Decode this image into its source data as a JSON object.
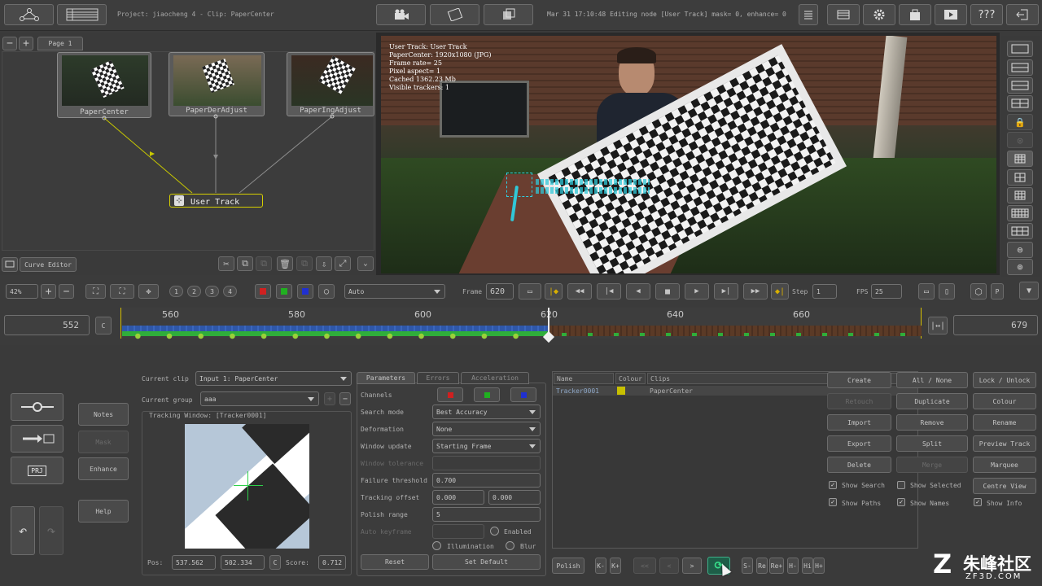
{
  "top": {
    "project_label": "Project: jiaocheng 4 - Clip: PaperCenter",
    "status_text": "Mar 31 17:10:48 Editing node [User Track] mask= 0, enhance= 0",
    "help_label": "???"
  },
  "flow": {
    "tab_page": "Page 1",
    "nodes": [
      {
        "label": "PaperCenter"
      },
      {
        "label": "PaperDerAdjust"
      },
      {
        "label": "PaperIngAdjust"
      }
    ],
    "user_track_label": "User Track",
    "curve_editor_label": "Curve Editor"
  },
  "viewer": {
    "info_lines": [
      "User Track: User Track",
      "PaperCenter: 1920x1080 (JPG)",
      "Frame rate= 25",
      "Pixel aspect= 1",
      "Cached 1362.23 Mb",
      "Visible trackers: 1"
    ]
  },
  "transport": {
    "zoom": "42%",
    "slot_labels": [
      "1",
      "2",
      "3",
      "4"
    ],
    "mode_value": "Auto",
    "frame_label": "Frame",
    "frame_value": "620",
    "step_label": "Step",
    "step_value": "1",
    "fps_label": "FPS",
    "fps_value": "25",
    "p_label": "P"
  },
  "timeline": {
    "start_frame": "552",
    "end_frame": "679",
    "c_label": "C",
    "ticks": [
      "560",
      "580",
      "600",
      "620",
      "640",
      "660"
    ]
  },
  "left_tools": {
    "notes": "Notes",
    "mask": "Mask",
    "enhance": "Enhance",
    "help": "Help",
    "prj_label": "PRJ"
  },
  "clip_panel": {
    "current_clip_label": "Current clip",
    "current_clip_value": "Input 1: PaperCenter",
    "current_group_label": "Current group",
    "current_group_value": "aaa",
    "tracking_window_label": "Tracking Window: [Tracker0001]",
    "pos_label": "Pos:",
    "pos_x": "537.562",
    "pos_y": "502.334",
    "c_label": "C",
    "score_label": "Score:",
    "score_value": "0.712"
  },
  "params": {
    "tabs": [
      "Parameters",
      "Errors",
      "Acceleration"
    ],
    "channels_label": "Channels",
    "search_mode_label": "Search mode",
    "search_mode_value": "Best Accuracy",
    "deformation_label": "Deformation",
    "deformation_value": "None",
    "window_update_label": "Window update",
    "window_update_value": "Starting Frame",
    "window_tolerance_label": "Window tolerance",
    "failure_threshold_label": "Failure threshold",
    "failure_threshold_value": "0.700",
    "tracking_offset_label": "Tracking offset",
    "tracking_offset_x": "0.000",
    "tracking_offset_y": "0.000",
    "polish_range_label": "Polish range",
    "polish_range_value": "5",
    "auto_keyframe_label": "Auto keyframe",
    "enabled_label": "Enabled",
    "illumination_label": "Illumination",
    "blur_label": "Blur",
    "reset_label": "Reset",
    "set_default_label": "Set Default"
  },
  "tracker_list": {
    "columns": [
      "Name",
      "Colour",
      "Clips"
    ],
    "rows": [
      {
        "name": "Tracker0001",
        "color": "#c8c000",
        "clip": "PaperCenter"
      }
    ],
    "bottom_buttons": [
      "Polish",
      "K-",
      "K+",
      "<<",
      "<",
      ">",
      "S-",
      "Re",
      "Re+",
      "H-",
      "Hi",
      "H+"
    ]
  },
  "actions": {
    "col1": [
      "Create",
      "Retouch",
      "Import",
      "Export",
      "Delete"
    ],
    "col2": [
      "All / None",
      "Duplicate",
      "Remove",
      "Split",
      "Merge"
    ],
    "col3": [
      "Lock / Unlock",
      "Colour",
      "Rename",
      "Preview Track",
      "Marquee"
    ],
    "show_search": "Show Search",
    "show_selected": "Show Selected",
    "centre_view": "Centre View",
    "show_paths": "Show Paths",
    "show_names": "Show Names",
    "show_info": "Show Info"
  },
  "watermark": {
    "brand": "朱峰社区",
    "url": "ZF3D.COM"
  }
}
